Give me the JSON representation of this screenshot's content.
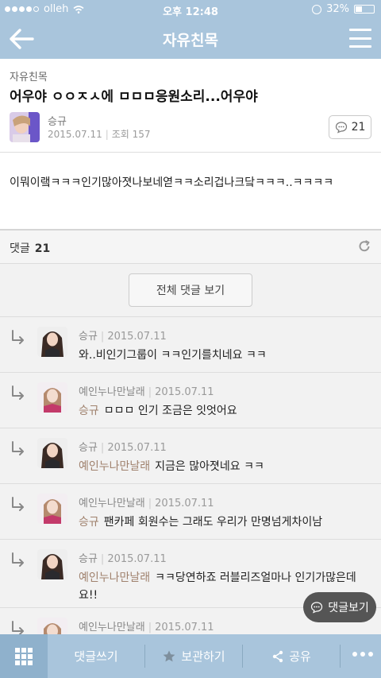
{
  "statusbar": {
    "carrier": "olleh",
    "time": "오후 12:48",
    "battery": "32%"
  },
  "nav": {
    "title": "자유친목"
  },
  "post": {
    "category": "자유친목",
    "title": "어우야 ㅇㅇㅈㅅ에 ㅁㅁㅁ응원소리...어우야",
    "author": "승규",
    "date": "2015.07.11",
    "views": "조회 157",
    "comment_count": "21",
    "body": "이뭐이랰ㅋㅋㅋ인기많아졋나보네엳ㅋㅋ소리겁나크닼ㅋㅋㅋ..ㅋㅋㅋㅋ"
  },
  "comments_section": {
    "label": "댓글",
    "count": "21",
    "view_all": "전체 댓글 보기",
    "items": [
      {
        "author": "승규",
        "date": "2015.07.11",
        "reply_to": "",
        "text": "와..비인기그룹이 ㅋㅋ인기를치네요 ㅋㅋ"
      },
      {
        "author": "예인누나만날래",
        "date": "2015.07.11",
        "reply_to": "승규",
        "text": "ㅁㅁㅁ 인기 조금은 잇엇어요"
      },
      {
        "author": "승규",
        "date": "2015.07.11",
        "reply_to": "예인누나만날래",
        "text": "지금은 많아졋네요 ㅋㅋ"
      },
      {
        "author": "예인누나만날래",
        "date": "2015.07.11",
        "reply_to": "승규",
        "text": "팬카페 회원수는 그래도 우리가 만명넘게차이남"
      },
      {
        "author": "승규",
        "date": "2015.07.11",
        "reply_to": "예인누나만날래",
        "text": "ㅋㅋ당연하죠 러블리즈얼마나 인기가많은데요!!"
      },
      {
        "author": "예인누나만날래",
        "date": "2015.07.11",
        "reply_to": "",
        "text": ""
      }
    ]
  },
  "floating": {
    "label": "댓글보기"
  },
  "tabbar": {
    "write_comment": "댓글쓰기",
    "save": "보관하기",
    "share": "공유"
  }
}
